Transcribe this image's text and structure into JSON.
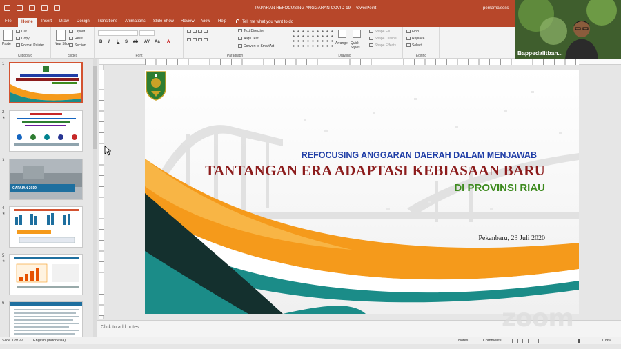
{
  "window": {
    "doc_title": "PAPARAN REFOCUSING ANGGARAN COVID-19  -  PowerPoint",
    "user_name": "pemarnaisess"
  },
  "ribbon_tabs": [
    "File",
    "Home",
    "Insert",
    "Draw",
    "Design",
    "Transitions",
    "Animations",
    "Slide Show",
    "Review",
    "View",
    "Help"
  ],
  "tell_me": "Tell me what you want to do",
  "ribbon": {
    "clipboard": {
      "paste": "Paste",
      "cut": "Cut",
      "copy": "Copy",
      "painter": "Format Painter",
      "label": "Clipboard"
    },
    "slides": {
      "new_slide": "New Slide",
      "layout": "Layout",
      "reset": "Reset",
      "section": "Section",
      "label": "Slides"
    },
    "font": {
      "label": "Font",
      "buttons": [
        "B",
        "I",
        "U",
        "S",
        "ab",
        "AV",
        "Aa",
        "A"
      ]
    },
    "paragraph": {
      "text_direction": "Text Direction",
      "align_text": "Align Text",
      "smartart": "Convert to SmartArt",
      "label": "Paragraph"
    },
    "drawing": {
      "arrange": "Arrange",
      "quick_styles": "Quick Styles",
      "shape_fill": "Shape Fill",
      "shape_outline": "Shape Outline",
      "shape_effects": "Shape Effects",
      "label": "Drawing"
    },
    "editing": {
      "find": "Find",
      "replace": "Replace",
      "select": "Select",
      "label": "Editing"
    }
  },
  "thumbnails": [
    {
      "num": "1",
      "caption": ""
    },
    {
      "num": "2",
      "caption": ""
    },
    {
      "num": "3",
      "caption": "CAPAIAN 2019"
    },
    {
      "num": "4",
      "caption": ""
    },
    {
      "num": "5",
      "caption": ""
    },
    {
      "num": "6",
      "caption": ""
    }
  ],
  "slide": {
    "subtitle": "REFOCUSING ANGGARAN DAERAH DALAM MENJAWAB",
    "title": "TANTANGAN ERA ADAPTASI KEBIASAAN BARU",
    "region": "DI PROVINSI RIAU",
    "place_date": "Pekanbaru, 23 Juli 2020",
    "colors": {
      "orange": "#f59a1b",
      "teal": "#1b8c88",
      "dark": "#14302e",
      "title_red": "#8c1c1c",
      "subtitle_blue": "#1f3da6",
      "region_green": "#3d8a1e"
    }
  },
  "notes_placeholder": "Click to add notes",
  "status": {
    "slide_info": "Slide 1 of 22",
    "language": "English (Indonesia)",
    "notes_btn": "Notes",
    "comments_btn": "Comments",
    "zoom_level": "109%"
  },
  "video": {
    "participant": "Bappedalitban..."
  },
  "watermark": "zoom",
  "accent": "#b7472a"
}
